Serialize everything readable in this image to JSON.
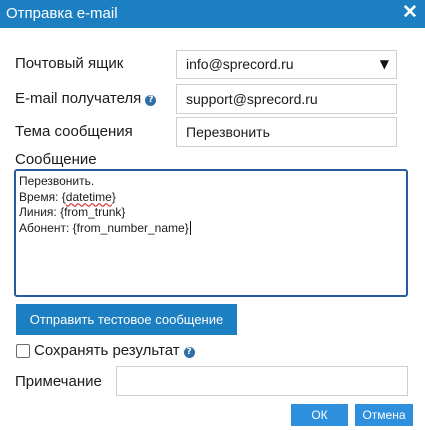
{
  "window": {
    "title": "Отправка e-mail",
    "close_icon": "close-icon"
  },
  "form": {
    "mailbox": {
      "label": "Почтовый ящик",
      "value": "info@sprecord.ru",
      "icon": "chevron-down-icon"
    },
    "recipient": {
      "label": "E-mail получателя",
      "value": "support@sprecord.ru",
      "help_icon": "help-icon"
    },
    "subject": {
      "label": "Тема сообщения",
      "value": "Перезвонить"
    },
    "message": {
      "label": "Сообщение",
      "lines": [
        "Перезвонить.",
        "Время: {",
        "datetime",
        "}",
        "Линия: {from_trunk}",
        "Абонент: {from_number_name}"
      ]
    },
    "test_button": "Отправить тестовое сообщение",
    "save_result": {
      "label": "Сохранять результат",
      "checked": false,
      "help_icon": "help-icon"
    },
    "note": {
      "label": "Примечание",
      "value": ""
    }
  },
  "footer": {
    "ok": "ОК",
    "cancel": "Отмена"
  },
  "colors": {
    "titlebar": "#1b7fc1",
    "button": "#1b7fc1",
    "footer_button": "#2e8fdc",
    "textarea_border": "#2a5a9c"
  }
}
